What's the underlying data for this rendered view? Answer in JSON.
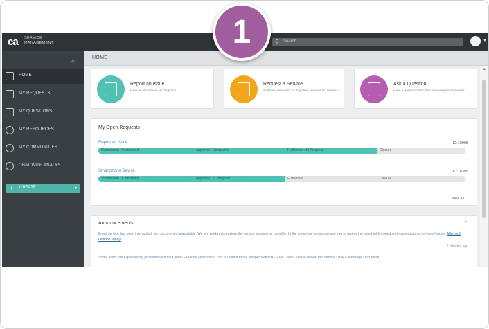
{
  "step_number": "1",
  "topbar": {
    "logo_mark": "ca",
    "logo_line1": "SERVICE",
    "logo_line2": "MANAGEMENT",
    "search_placeholder": "Search"
  },
  "sidebar": {
    "collapse_glyph": "«",
    "items": [
      {
        "label": "HOME",
        "icon": "home-icon"
      },
      {
        "label": "MY REQUESTS",
        "icon": "requests-icon"
      },
      {
        "label": "MY QUESTIONS",
        "icon": "questions-icon"
      },
      {
        "label": "MY RESOURCES",
        "icon": "resources-icon"
      },
      {
        "label": "MY COMMUNITIES",
        "icon": "communities-icon"
      },
      {
        "label": "CHAT WITH ANALYST",
        "icon": "chat-icon"
      }
    ],
    "create_label": "CREATE"
  },
  "page_title": "HOME",
  "tiles": [
    {
      "title": "Report an Issue...",
      "subtitle": "Have an issue? We can help fix it.",
      "color": "#4fc2b3"
    },
    {
      "title": "Request a Service...",
      "subtitle": "Software, hardware, or any other service? Go request it.",
      "color": "#f3a51c"
    },
    {
      "title": "Ask a Question...",
      "subtitle": "Have a question? Ask the community for an answer.",
      "color": "#b55db1"
    }
  ],
  "open_requests": {
    "heading": "My Open Requests",
    "items": [
      {
        "name": "Report an Issue",
        "id": "ID:10908",
        "stages": [
          {
            "label": "Submission : Completed",
            "done": true
          },
          {
            "label": "Approval : Completed",
            "done": true
          },
          {
            "label": "Fulfillment : In Progress",
            "done": true
          },
          {
            "label": "Closure",
            "done": false
          }
        ]
      },
      {
        "name": "Smartphone Device",
        "id": "ID:10399",
        "stages": [
          {
            "label": "Submission : Completed",
            "done": true
          },
          {
            "label": "Approval : In Progress",
            "done": true
          },
          {
            "label": "Fulfillment",
            "done": false
          },
          {
            "label": "Closure",
            "done": false
          }
        ]
      }
    ],
    "view_all": "View All..."
  },
  "announcements": {
    "heading": "Announcements",
    "text1": "Email service has been interrupted, and is currently unavailable. We are working to restore the service as soon as possible. In the meantime we encourage you to review the attached",
    "text2": "knowledge document about the new feature:",
    "link": "Microsoft Outlook Today",
    "time1": "7 Minutes ago",
    "text3": "Some users are experiencing problems with the Global Expense application. This is related to the Juniper Network - VPN Client. Please review the Service Desk Knowledge Document"
  },
  "colors": {
    "accent_teal": "#4fc2b3",
    "sidebar_bg": "#3a3f44",
    "badge_purple": "#a25d9f"
  }
}
